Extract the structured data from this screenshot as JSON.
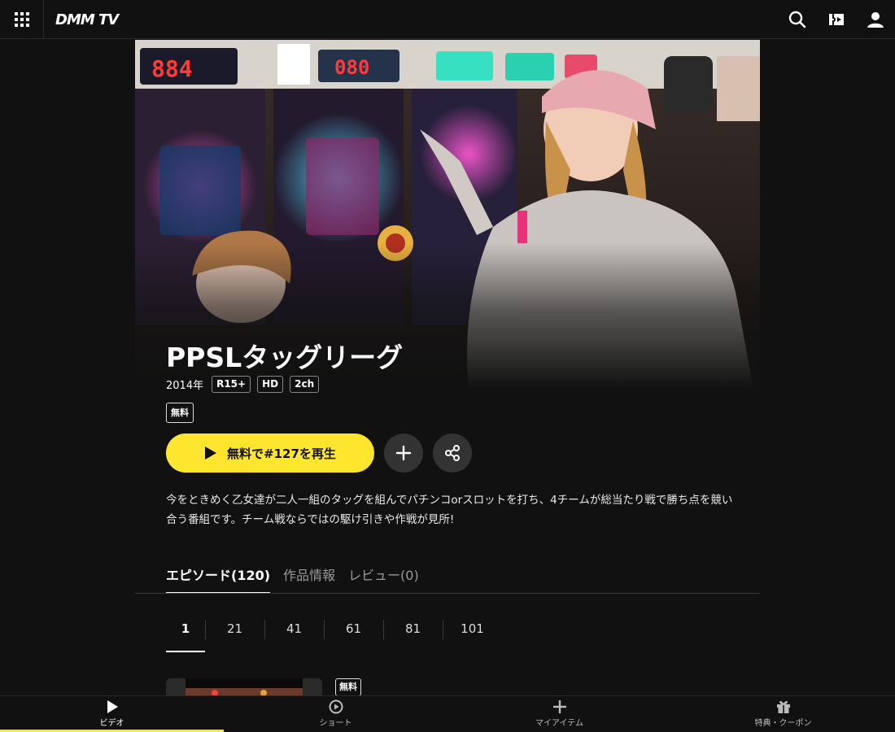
{
  "header": {
    "logo": "DMM TV",
    "icons": [
      "grid-menu-icon",
      "search-icon",
      "ticket-icon",
      "user-icon"
    ]
  },
  "hero": {
    "image": "pachinko-parlor-two-women-photo"
  },
  "title": "PPSLタッグリーグ",
  "meta": {
    "year": "2014年",
    "tags": [
      "R15+",
      "HD",
      "2ch"
    ]
  },
  "badge_free": "無料",
  "actions": {
    "play_label": "無料で#127を再生",
    "add_icon": "plus-icon",
    "share_icon": "share-icon"
  },
  "description": "今をときめく乙女達が二人一組のタッグを組んでパチンコorスロットを打ち、4チームが総当たり戦で勝ち点を競い合う番組です。チーム戦ならではの駆け引きや作戦が見所!",
  "tabs": [
    {
      "label": "エピソード(120)",
      "active": true
    },
    {
      "label": "作品情報",
      "active": false
    },
    {
      "label": "レビュー(0)",
      "active": false
    }
  ],
  "pages": [
    "1",
    "21",
    "41",
    "61",
    "81",
    "101"
  ],
  "episode_badge": "無料",
  "bottom_nav": [
    {
      "label": "ビデオ",
      "icon": "play-icon",
      "active": true
    },
    {
      "label": "ショート",
      "icon": "short-play-icon",
      "active": false
    },
    {
      "label": "マイアイテム",
      "icon": "plus-icon",
      "active": false
    },
    {
      "label": "特典・クーポン",
      "icon": "gift-icon",
      "active": false
    }
  ],
  "colors": {
    "background": "#111111",
    "accent": "#ffe62e",
    "circle_button": "#333333"
  }
}
